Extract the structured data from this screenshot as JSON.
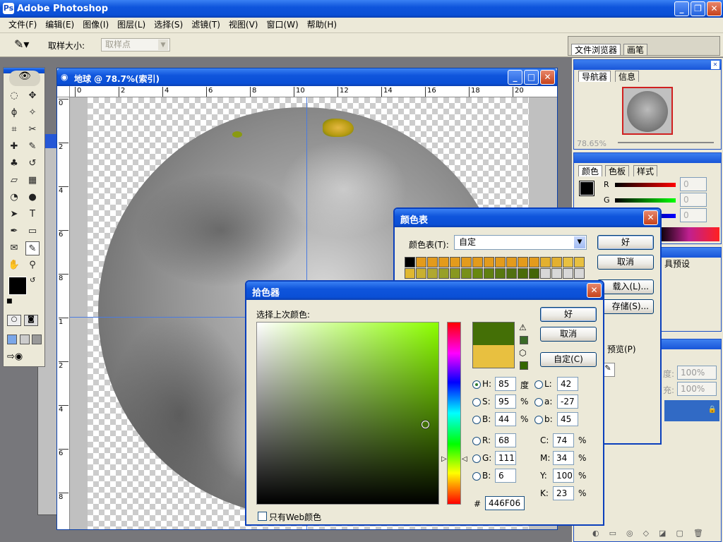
{
  "app": {
    "title": "Adobe Photoshop"
  },
  "menu": [
    "文件(F)",
    "编辑(E)",
    "图像(I)",
    "图层(L)",
    "选择(S)",
    "滤镜(T)",
    "视图(V)",
    "窗口(W)",
    "帮助(H)"
  ],
  "options_bar": {
    "sample_size_label": "取样大小:",
    "sample_size_value": "取样点"
  },
  "palette_well": {
    "tabs": [
      "文件浏览器",
      "画笔"
    ]
  },
  "document": {
    "title": "地球 @ 78.7%(索引)",
    "ruler_h": [
      "0",
      "2",
      "4",
      "6",
      "8",
      "10",
      "12",
      "14",
      "16",
      "18",
      "20"
    ],
    "ruler_v": [
      "0",
      "2",
      "4",
      "6",
      "8",
      "1",
      "2",
      "4",
      "6",
      "8"
    ]
  },
  "navigator": {
    "tabs": [
      "导航器",
      "信息"
    ],
    "zoom": "78.65%"
  },
  "color_panel": {
    "tabs": [
      "颜色",
      "色板",
      "样式"
    ],
    "channels": [
      {
        "label": "R",
        "value": "0"
      },
      {
        "label": "G",
        "value": "0"
      },
      {
        "label": "B",
        "value": "0"
      }
    ]
  },
  "history_panel": {
    "tab_fragment": "具预设"
  },
  "layers_panel": {
    "opacity_label": "度:",
    "opacity": "100%",
    "fill_label": "充:",
    "fill": "100%"
  },
  "color_table": {
    "title": "颜色表",
    "table_label": "颜色表(T):",
    "table_value": "自定",
    "ok": "好",
    "cancel": "取消",
    "load": "载入(L)...",
    "save": "存储(S)...",
    "preview": "预览(P)",
    "row1": [
      "#000000",
      "#e39b1c",
      "#e39b1c",
      "#e39b1c",
      "#e39b1c",
      "#e39b1c",
      "#e39b1c",
      "#e39b1c",
      "#e39b1c",
      "#e39b1c",
      "#e39b1c",
      "#e39b1c",
      "#e3b030",
      "#e3b030",
      "#e8c040",
      "#e8c040"
    ],
    "row2": [
      "#e0b830",
      "#c8b030",
      "#b0a830",
      "#98a028",
      "#889820",
      "#789018",
      "#688810",
      "#608010",
      "#587810",
      "#507010",
      "#4a6c08",
      "#446608",
      "#d8d8d8",
      "#d8d8d8",
      "#d8d8d8",
      "#d8d8d8"
    ]
  },
  "picker": {
    "title": "拾色器",
    "prompt": "选择上次颜色:",
    "ok": "好",
    "cancel": "取消",
    "custom": "自定(C)",
    "new_color": "#446F06",
    "old_color": "#e8c040",
    "fields": {
      "H": {
        "label": "H:",
        "value": "85",
        "unit": "度"
      },
      "S": {
        "label": "S:",
        "value": "95",
        "unit": "%"
      },
      "Bv": {
        "label": "B:",
        "value": "44",
        "unit": "%"
      },
      "R": {
        "label": "R:",
        "value": "68"
      },
      "G": {
        "label": "G:",
        "value": "111"
      },
      "B": {
        "label": "B:",
        "value": "6"
      },
      "L": {
        "label": "L:",
        "value": "42"
      },
      "a": {
        "label": "a:",
        "value": "-27"
      },
      "b": {
        "label": "b:",
        "value": "45"
      },
      "C": {
        "label": "C:",
        "value": "74",
        "unit": "%"
      },
      "M": {
        "label": "M:",
        "value": "34",
        "unit": "%"
      },
      "Y": {
        "label": "Y:",
        "value": "100",
        "unit": "%"
      },
      "K": {
        "label": "K:",
        "value": "23",
        "unit": "%"
      }
    },
    "hash": "#",
    "hex": "446F06",
    "web_only": "只有Web颜色"
  }
}
